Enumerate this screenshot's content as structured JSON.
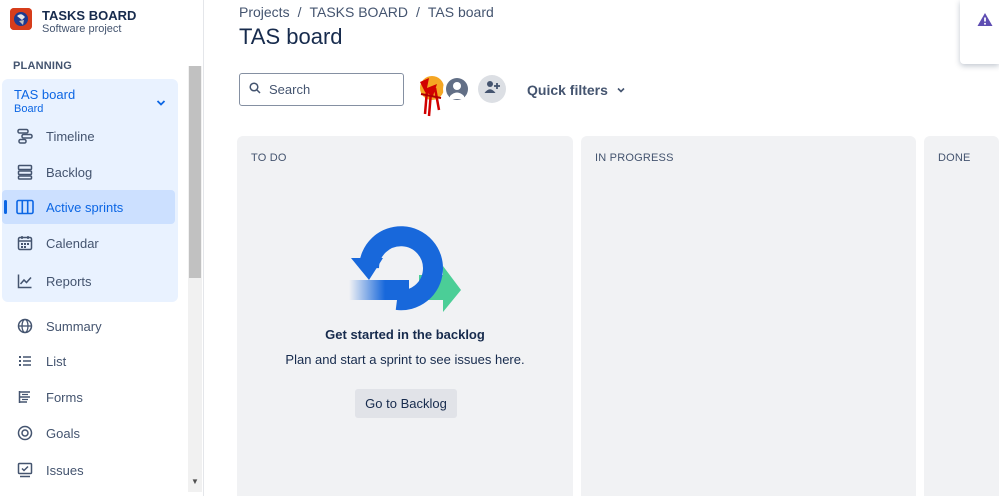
{
  "project": {
    "title": "TASKS BOARD",
    "subtitle": "Software project"
  },
  "sidebar": {
    "section_label": "PLANNING",
    "board": {
      "title": "TAS board",
      "subtitle": "Board"
    },
    "items": [
      {
        "label": "Timeline",
        "icon": "timeline-icon"
      },
      {
        "label": "Backlog",
        "icon": "backlog-icon"
      },
      {
        "label": "Active sprints",
        "icon": "active-sprints-icon",
        "active": true
      },
      {
        "label": "Calendar",
        "icon": "calendar-icon"
      },
      {
        "label": "Reports",
        "icon": "reports-icon"
      },
      {
        "label": "Summary",
        "icon": "summary-icon"
      },
      {
        "label": "List",
        "icon": "list-icon"
      },
      {
        "label": "Forms",
        "icon": "forms-icon"
      },
      {
        "label": "Goals",
        "icon": "goals-icon"
      },
      {
        "label": "Issues",
        "icon": "issues-icon"
      }
    ]
  },
  "breadcrumb": [
    "Projects",
    "TASKS BOARD",
    "TAS board"
  ],
  "page_title": "TAS board",
  "toolbar": {
    "search_placeholder": "Search",
    "quick_filters_label": "Quick filters"
  },
  "columns": [
    {
      "title": "TO DO"
    },
    {
      "title": "IN PROGRESS"
    },
    {
      "title": "DONE"
    }
  ],
  "empty_state": {
    "title": "Get started in the backlog",
    "description": "Plan and start a sprint to see issues here.",
    "button_label": "Go to Backlog"
  },
  "colors": {
    "accent": "#0c66e4",
    "active_bg": "#cce0ff",
    "group_bg": "#e9f2ff",
    "column_bg": "#f1f2f4",
    "warning": "#5e4db2"
  }
}
